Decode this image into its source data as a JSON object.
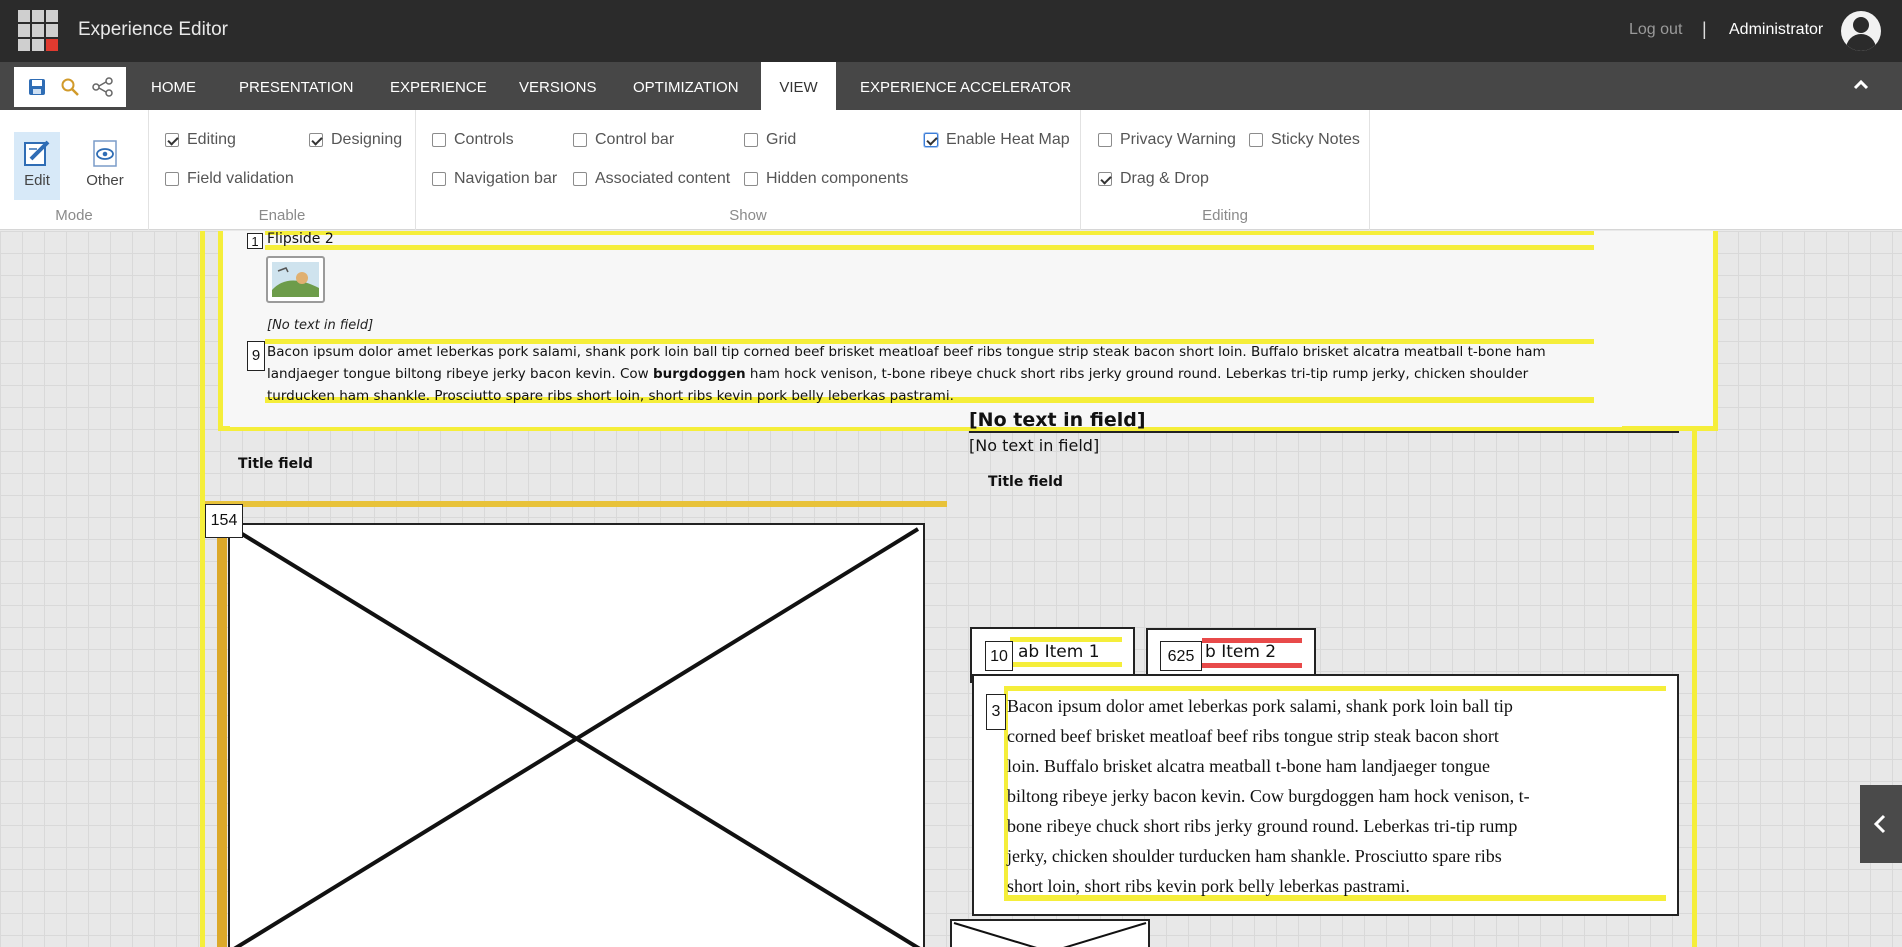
{
  "header": {
    "app_title": "Experience Editor",
    "logout_label": "Log out",
    "separator": "|",
    "user_name": "Administrator"
  },
  "tabs": [
    {
      "label": "HOME"
    },
    {
      "label": "PRESENTATION"
    },
    {
      "label": "EXPERIENCE"
    },
    {
      "label": "VERSIONS"
    },
    {
      "label": "OPTIMIZATION"
    },
    {
      "label": "VIEW",
      "active": true
    },
    {
      "label": "EXPERIENCE ACCELERATOR"
    }
  ],
  "quick_access": {
    "icons": [
      "save-icon",
      "search-icon",
      "sitemap-icon"
    ]
  },
  "ribbon": {
    "mode": {
      "group_label": "Mode",
      "edit_label": "Edit",
      "other_label": "Other"
    },
    "enable": {
      "group_label": "Enable",
      "editing": {
        "label": "Editing",
        "checked": true
      },
      "designing": {
        "label": "Designing",
        "checked": true
      },
      "field_validation": {
        "label": "Field validation",
        "checked": false
      }
    },
    "show": {
      "group_label": "Show",
      "controls": {
        "label": "Controls",
        "checked": false
      },
      "control_bar": {
        "label": "Control bar",
        "checked": false
      },
      "grid": {
        "label": "Grid",
        "checked": false
      },
      "enable_heat_map": {
        "label": "Enable Heat Map",
        "checked": true
      },
      "navigation_bar": {
        "label": "Navigation bar",
        "checked": false
      },
      "associated_content": {
        "label": "Associated content",
        "checked": false
      },
      "hidden_components": {
        "label": "Hidden components",
        "checked": false
      }
    },
    "editing": {
      "group_label": "Editing",
      "privacy_warning": {
        "label": "Privacy Warning",
        "checked": false
      },
      "sticky_notes": {
        "label": "Sticky Notes",
        "checked": false
      },
      "drag_drop": {
        "label": "Drag & Drop",
        "checked": true
      }
    }
  },
  "canvas": {
    "flipside": {
      "badge": "1",
      "title": "Flipside 2",
      "no_text": "[No text in field]"
    },
    "body_text": {
      "badge": "9",
      "part1": "Bacon ipsum dolor amet leberkas pork salami, shank pork loin ball tip corned beef brisket meatloaf beef ribs tongue strip steak bacon short loin. Buffalo brisket alcatra meatball t-bone ham landjaeger tongue biltong ribeye jerky bacon kevin. Cow ",
      "bold": "burgdoggen",
      "part2": " ham hock venison, t-bone ribeye chuck short ribs jerky ground round. Leberkas tri-tip rump jerky, chicken shoulder turducken ham shankle. Prosciutto spare ribs short loin, short ribs kevin pork belly leberkas pastrami."
    },
    "title_field_1": "Title field",
    "image_badge": "154",
    "heading_no_text": "[No text in field]",
    "sub_no_text": "[No text in field]",
    "title_field_2": "Title field",
    "tab1": {
      "badge": "10",
      "label": "ab Item 1"
    },
    "tab2": {
      "badge": "625",
      "label": "b Item 2"
    },
    "tab_content": {
      "badge": "3",
      "lines": [
        "Bacon ipsum dolor amet leberkas pork salami, shank pork loin ball tip",
        "corned beef brisket meatloaf beef ribs tongue strip steak bacon short",
        "loin. Buffalo brisket alcatra meatball t-bone ham landjaeger tongue",
        "biltong ribeye jerky bacon kevin. Cow burgdoggen ham hock venison, t-",
        "bone ribeye chuck short ribs jerky ground round. Leberkas tri-tip rump",
        "jerky, chicken shoulder turducken ham shankle. Prosciutto spare ribs",
        "short loin, short ribs kevin pork belly leberkas pastrami."
      ]
    }
  },
  "colors": {
    "heatmap_yellow": "#f5ee3a",
    "heatmap_red": "#e84a4a",
    "topbar": "#2b2b2b",
    "tabbar": "#474747"
  }
}
